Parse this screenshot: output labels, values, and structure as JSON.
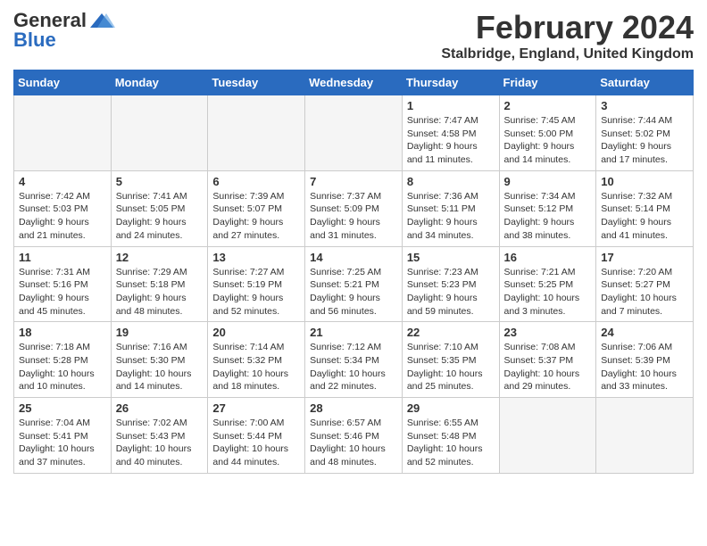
{
  "logo": {
    "general": "General",
    "blue": "Blue"
  },
  "title": {
    "month": "February 2024",
    "location": "Stalbridge, England, United Kingdom"
  },
  "headers": [
    "Sunday",
    "Monday",
    "Tuesday",
    "Wednesday",
    "Thursday",
    "Friday",
    "Saturday"
  ],
  "weeks": [
    [
      {
        "day": "",
        "sunrise": "",
        "sunset": "",
        "daylight": "",
        "empty": true
      },
      {
        "day": "",
        "sunrise": "",
        "sunset": "",
        "daylight": "",
        "empty": true
      },
      {
        "day": "",
        "sunrise": "",
        "sunset": "",
        "daylight": "",
        "empty": true
      },
      {
        "day": "",
        "sunrise": "",
        "sunset": "",
        "daylight": "",
        "empty": true
      },
      {
        "day": "1",
        "sunrise": "Sunrise: 7:47 AM",
        "sunset": "Sunset: 4:58 PM",
        "daylight": "Daylight: 9 hours and 11 minutes.",
        "empty": false
      },
      {
        "day": "2",
        "sunrise": "Sunrise: 7:45 AM",
        "sunset": "Sunset: 5:00 PM",
        "daylight": "Daylight: 9 hours and 14 minutes.",
        "empty": false
      },
      {
        "day": "3",
        "sunrise": "Sunrise: 7:44 AM",
        "sunset": "Sunset: 5:02 PM",
        "daylight": "Daylight: 9 hours and 17 minutes.",
        "empty": false
      }
    ],
    [
      {
        "day": "4",
        "sunrise": "Sunrise: 7:42 AM",
        "sunset": "Sunset: 5:03 PM",
        "daylight": "Daylight: 9 hours and 21 minutes.",
        "empty": false
      },
      {
        "day": "5",
        "sunrise": "Sunrise: 7:41 AM",
        "sunset": "Sunset: 5:05 PM",
        "daylight": "Daylight: 9 hours and 24 minutes.",
        "empty": false
      },
      {
        "day": "6",
        "sunrise": "Sunrise: 7:39 AM",
        "sunset": "Sunset: 5:07 PM",
        "daylight": "Daylight: 9 hours and 27 minutes.",
        "empty": false
      },
      {
        "day": "7",
        "sunrise": "Sunrise: 7:37 AM",
        "sunset": "Sunset: 5:09 PM",
        "daylight": "Daylight: 9 hours and 31 minutes.",
        "empty": false
      },
      {
        "day": "8",
        "sunrise": "Sunrise: 7:36 AM",
        "sunset": "Sunset: 5:11 PM",
        "daylight": "Daylight: 9 hours and 34 minutes.",
        "empty": false
      },
      {
        "day": "9",
        "sunrise": "Sunrise: 7:34 AM",
        "sunset": "Sunset: 5:12 PM",
        "daylight": "Daylight: 9 hours and 38 minutes.",
        "empty": false
      },
      {
        "day": "10",
        "sunrise": "Sunrise: 7:32 AM",
        "sunset": "Sunset: 5:14 PM",
        "daylight": "Daylight: 9 hours and 41 minutes.",
        "empty": false
      }
    ],
    [
      {
        "day": "11",
        "sunrise": "Sunrise: 7:31 AM",
        "sunset": "Sunset: 5:16 PM",
        "daylight": "Daylight: 9 hours and 45 minutes.",
        "empty": false
      },
      {
        "day": "12",
        "sunrise": "Sunrise: 7:29 AM",
        "sunset": "Sunset: 5:18 PM",
        "daylight": "Daylight: 9 hours and 48 minutes.",
        "empty": false
      },
      {
        "day": "13",
        "sunrise": "Sunrise: 7:27 AM",
        "sunset": "Sunset: 5:19 PM",
        "daylight": "Daylight: 9 hours and 52 minutes.",
        "empty": false
      },
      {
        "day": "14",
        "sunrise": "Sunrise: 7:25 AM",
        "sunset": "Sunset: 5:21 PM",
        "daylight": "Daylight: 9 hours and 56 minutes.",
        "empty": false
      },
      {
        "day": "15",
        "sunrise": "Sunrise: 7:23 AM",
        "sunset": "Sunset: 5:23 PM",
        "daylight": "Daylight: 9 hours and 59 minutes.",
        "empty": false
      },
      {
        "day": "16",
        "sunrise": "Sunrise: 7:21 AM",
        "sunset": "Sunset: 5:25 PM",
        "daylight": "Daylight: 10 hours and 3 minutes.",
        "empty": false
      },
      {
        "day": "17",
        "sunrise": "Sunrise: 7:20 AM",
        "sunset": "Sunset: 5:27 PM",
        "daylight": "Daylight: 10 hours and 7 minutes.",
        "empty": false
      }
    ],
    [
      {
        "day": "18",
        "sunrise": "Sunrise: 7:18 AM",
        "sunset": "Sunset: 5:28 PM",
        "daylight": "Daylight: 10 hours and 10 minutes.",
        "empty": false
      },
      {
        "day": "19",
        "sunrise": "Sunrise: 7:16 AM",
        "sunset": "Sunset: 5:30 PM",
        "daylight": "Daylight: 10 hours and 14 minutes.",
        "empty": false
      },
      {
        "day": "20",
        "sunrise": "Sunrise: 7:14 AM",
        "sunset": "Sunset: 5:32 PM",
        "daylight": "Daylight: 10 hours and 18 minutes.",
        "empty": false
      },
      {
        "day": "21",
        "sunrise": "Sunrise: 7:12 AM",
        "sunset": "Sunset: 5:34 PM",
        "daylight": "Daylight: 10 hours and 22 minutes.",
        "empty": false
      },
      {
        "day": "22",
        "sunrise": "Sunrise: 7:10 AM",
        "sunset": "Sunset: 5:35 PM",
        "daylight": "Daylight: 10 hours and 25 minutes.",
        "empty": false
      },
      {
        "day": "23",
        "sunrise": "Sunrise: 7:08 AM",
        "sunset": "Sunset: 5:37 PM",
        "daylight": "Daylight: 10 hours and 29 minutes.",
        "empty": false
      },
      {
        "day": "24",
        "sunrise": "Sunrise: 7:06 AM",
        "sunset": "Sunset: 5:39 PM",
        "daylight": "Daylight: 10 hours and 33 minutes.",
        "empty": false
      }
    ],
    [
      {
        "day": "25",
        "sunrise": "Sunrise: 7:04 AM",
        "sunset": "Sunset: 5:41 PM",
        "daylight": "Daylight: 10 hours and 37 minutes.",
        "empty": false
      },
      {
        "day": "26",
        "sunrise": "Sunrise: 7:02 AM",
        "sunset": "Sunset: 5:43 PM",
        "daylight": "Daylight: 10 hours and 40 minutes.",
        "empty": false
      },
      {
        "day": "27",
        "sunrise": "Sunrise: 7:00 AM",
        "sunset": "Sunset: 5:44 PM",
        "daylight": "Daylight: 10 hours and 44 minutes.",
        "empty": false
      },
      {
        "day": "28",
        "sunrise": "Sunrise: 6:57 AM",
        "sunset": "Sunset: 5:46 PM",
        "daylight": "Daylight: 10 hours and 48 minutes.",
        "empty": false
      },
      {
        "day": "29",
        "sunrise": "Sunrise: 6:55 AM",
        "sunset": "Sunset: 5:48 PM",
        "daylight": "Daylight: 10 hours and 52 minutes.",
        "empty": false
      },
      {
        "day": "",
        "sunrise": "",
        "sunset": "",
        "daylight": "",
        "empty": true
      },
      {
        "day": "",
        "sunrise": "",
        "sunset": "",
        "daylight": "",
        "empty": true
      }
    ]
  ]
}
